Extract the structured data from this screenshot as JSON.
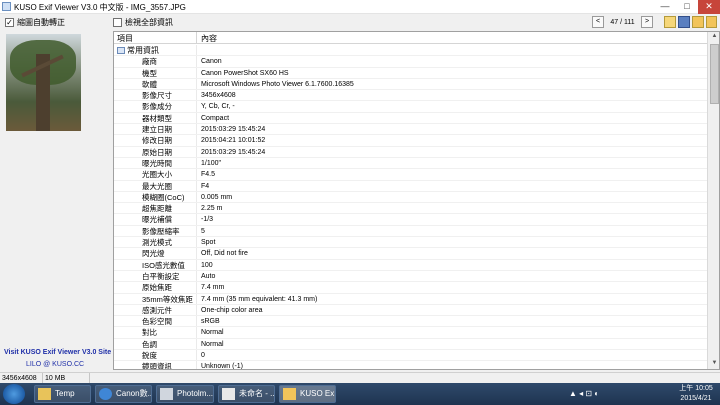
{
  "window": {
    "title": "KUSO Exif Viewer V3.0 中文版 - IMG_3557.JPG",
    "min": "—",
    "max": "□",
    "close": "✕"
  },
  "toolbar": {
    "auto_rotate_label": "縮圖自動轉正",
    "auto_rotate_checked": "✓",
    "show_all_label": "檢視全部資訊",
    "prev": "<",
    "next": ">",
    "counter": "47 / 111"
  },
  "left": {
    "site_link": "Visit KUSO Exif Viewer V3.0 Site",
    "credit": "LILO @ KUSO.CC"
  },
  "exif": {
    "col_item": "項目",
    "col_content": "內容",
    "group": "常用資訊",
    "rows": [
      {
        "k": "廠商",
        "v": "Canon"
      },
      {
        "k": "機型",
        "v": "Canon PowerShot SX60 HS"
      },
      {
        "k": "軟體",
        "v": "Microsoft Windows Photo Viewer 6.1.7600.16385"
      },
      {
        "k": "影像尺寸",
        "v": "3456x4608"
      },
      {
        "k": "影像成分",
        "v": "Y, Cb, Cr, -"
      },
      {
        "k": "器材類型",
        "v": "Compact"
      },
      {
        "k": "建立日期",
        "v": "2015:03:29 15:45:24"
      },
      {
        "k": "修改日期",
        "v": "2015:04:21 10:01:52"
      },
      {
        "k": "原始日期",
        "v": "2015:03:29 15:45:24"
      },
      {
        "k": "曝光時間",
        "v": "1/100\""
      },
      {
        "k": "光圈大小",
        "v": "F4.5"
      },
      {
        "k": "最大光圈",
        "v": "F4"
      },
      {
        "k": "模糊圈(CoC)",
        "v": "0.005 mm"
      },
      {
        "k": "超焦距離",
        "v": "2.25 m"
      },
      {
        "k": "曝光補償",
        "v": "-1/3"
      },
      {
        "k": "影像壓縮率",
        "v": "5"
      },
      {
        "k": "測光模式",
        "v": "Spot"
      },
      {
        "k": "閃光燈",
        "v": "Off, Did not fire"
      },
      {
        "k": "ISO感光數值",
        "v": "100"
      },
      {
        "k": "白平衡設定",
        "v": "Auto"
      },
      {
        "k": "原始焦距",
        "v": "7.4 mm"
      },
      {
        "k": "35mm等效焦距",
        "v": "7.4 mm (35 mm equivalent: 41.3 mm)"
      },
      {
        "k": "感測元件",
        "v": "One-chip color area"
      },
      {
        "k": "色彩空間",
        "v": "sRGB"
      },
      {
        "k": "對比",
        "v": "Normal"
      },
      {
        "k": "色調",
        "v": "Normal"
      },
      {
        "k": "銳度",
        "v": "0"
      },
      {
        "k": "鏡頭資訊",
        "v": "Unknown (-1)"
      }
    ]
  },
  "status": {
    "dimensions": "3456x4608",
    "size": "10 MB"
  },
  "taskbar": {
    "items": [
      "Temp",
      "Canon數...",
      "Photolm...",
      "未命名 - ...",
      "KUSO Ex..."
    ],
    "clock_time": "上午 10:05",
    "clock_date": "2015/4/21",
    "tray": "▲ ◂ ⊡ ◐"
  }
}
